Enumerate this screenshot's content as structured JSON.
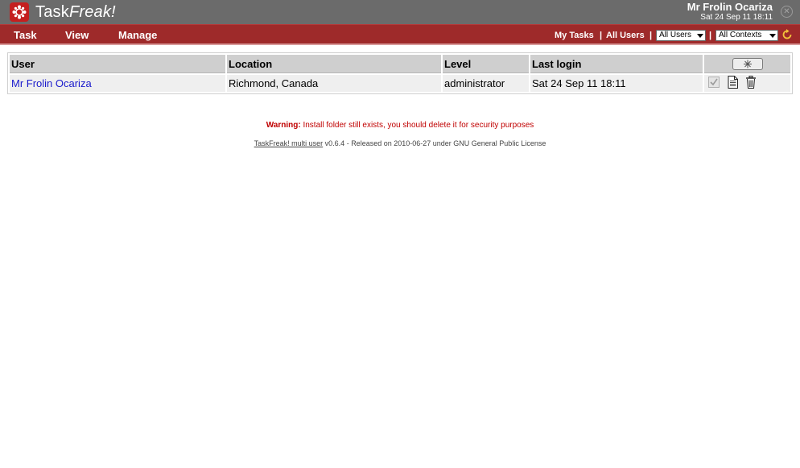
{
  "app": {
    "title_prefix": "Task",
    "title_suffix": "Freak!"
  },
  "user": {
    "name": "Mr Frolin Ocariza",
    "datetime": "Sat 24 Sep 11 18:11"
  },
  "menu": {
    "items": [
      "Task",
      "View",
      "Manage"
    ]
  },
  "nav": {
    "my_tasks": "My Tasks",
    "separator": "|",
    "all_users": "All Users",
    "users_select": "All Users",
    "contexts_select": "All Contexts"
  },
  "table": {
    "headers": {
      "user": "User",
      "location": "Location",
      "level": "Level",
      "last_login": "Last login"
    },
    "rows": [
      {
        "user": "Mr Frolin Ocariza",
        "location": "Richmond, Canada",
        "level": "administrator",
        "last_login": "Sat 24 Sep 11 18:11"
      }
    ]
  },
  "warning": {
    "label": "Warning:",
    "text": " Install folder still exists, you should delete it for security purposes"
  },
  "footer": {
    "link": "TaskFreak! multi user",
    "text": " v0.6.4 - Released on 2010-06-27 under GNU General Public License"
  },
  "colors": {
    "header_bg": "#6b6b6b",
    "menubar_bg": "#9e2a2a",
    "logo_red": "#c41f1f",
    "link_blue": "#1a1acc",
    "warning_red": "#c00000"
  },
  "icons": [
    "taskfreak-logo-icon",
    "close-icon",
    "dropdown-arrow-icon",
    "refresh-icon",
    "add-user-icon",
    "checkmark-icon",
    "document-icon",
    "trash-icon"
  ]
}
